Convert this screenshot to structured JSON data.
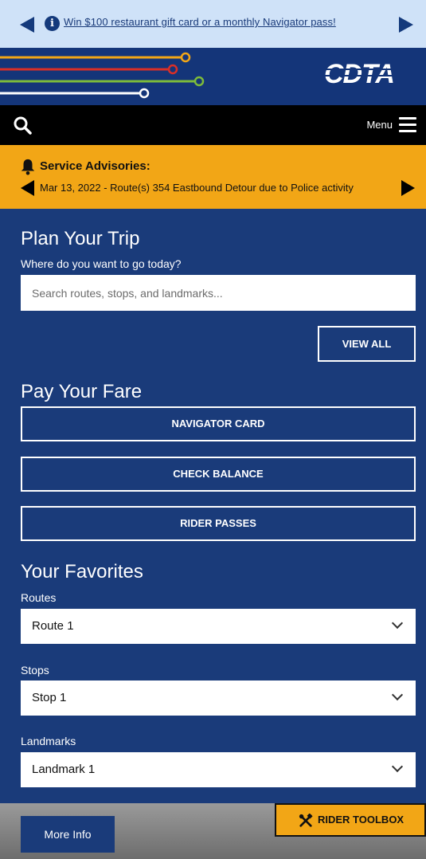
{
  "promo": {
    "text": "Win $100 restaurant gift card or a monthly Navigator pass!",
    "info_icon": "i"
  },
  "header": {
    "logo_text": "CDTA",
    "line_colors": [
      "#f2a616",
      "#d92f27",
      "#7dbb3a",
      "#ffffff"
    ]
  },
  "navbar": {
    "menu_label": "Menu"
  },
  "advisory": {
    "title": "Service Advisories:",
    "message": "Mar 13, 2022 - Route(s) 354 Eastbound Detour due to Police activity"
  },
  "plan": {
    "title": "Plan Your Trip",
    "prompt": "Where do you want to go today?",
    "search_placeholder": "Search routes, stops, and landmarks...",
    "view_all_label": "VIEW ALL"
  },
  "fare": {
    "title": "Pay Your Fare",
    "buttons": [
      "NAVIGATOR CARD",
      "CHECK BALANCE",
      "RIDER PASSES"
    ]
  },
  "favorites": {
    "title": "Your Favorites",
    "routes_label": "Routes",
    "routes_value": "Route 1",
    "stops_label": "Stops",
    "stops_value": "Stop 1",
    "landmarks_label": "Landmarks",
    "landmarks_value": "Landmark 1"
  },
  "footer": {
    "more_info_label": "More Info",
    "toolbox_label": "RIDER TOOLBOX"
  },
  "colors": {
    "brand_blue": "#1a3b7a",
    "accent_gold": "#f2a616",
    "promo_bg": "#cfe2f8"
  }
}
